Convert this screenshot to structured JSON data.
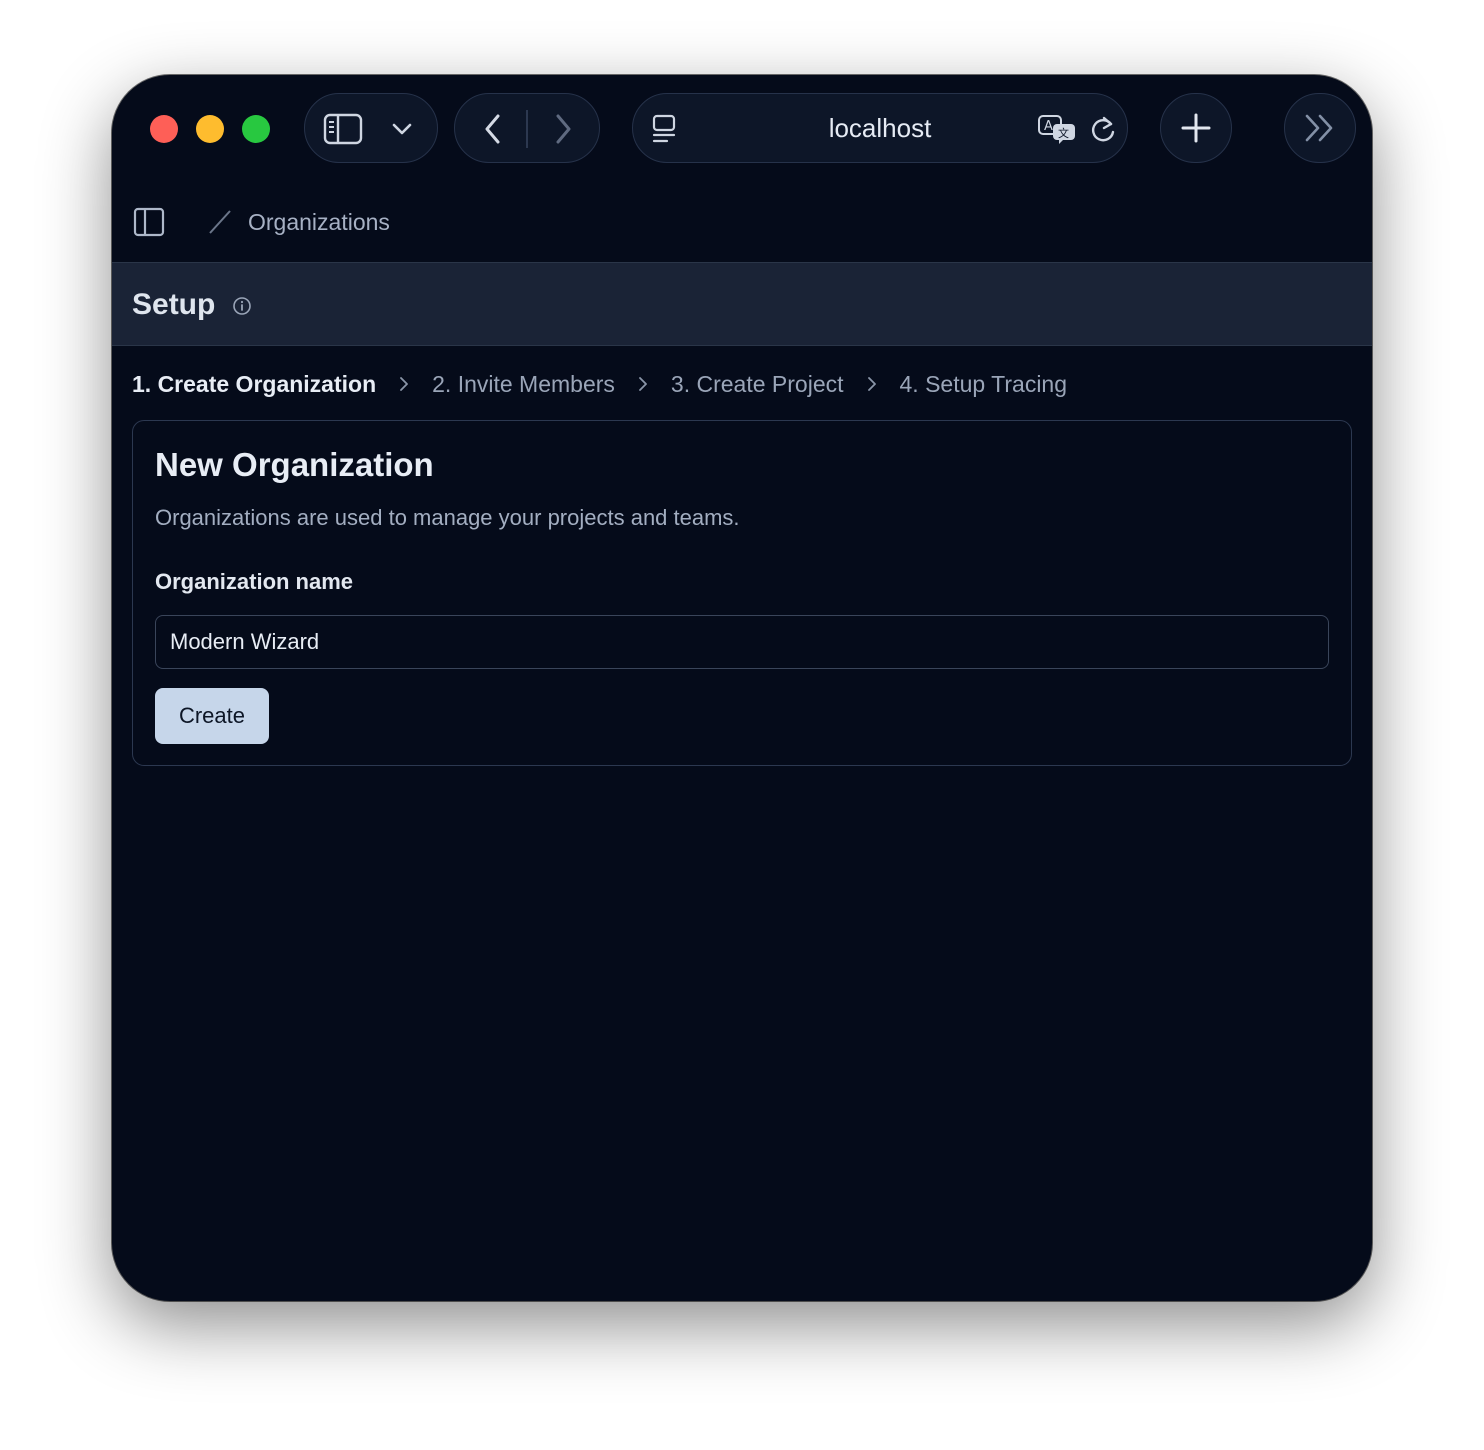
{
  "browser": {
    "url": "localhost",
    "icons": {
      "sidebar": "sidebar-icon",
      "dropdown": "chevron-down-icon",
      "back": "chevron-left-icon",
      "forward": "chevron-right-icon",
      "page_menu": "page-menu-icon",
      "translate": "translate-icon",
      "reload": "reload-icon",
      "new_tab": "plus-icon",
      "more": "double-chevron-right-icon"
    },
    "traffic_lights": [
      "#fe5f57",
      "#febc2e",
      "#28c840"
    ]
  },
  "app": {
    "breadcrumb": "Organizations",
    "page_title": "Setup",
    "steps": [
      {
        "label": "1. Create Organization",
        "active": true
      },
      {
        "label": "2. Invite Members",
        "active": false
      },
      {
        "label": "3. Create Project",
        "active": false
      },
      {
        "label": "4. Setup Tracing",
        "active": false
      }
    ],
    "card": {
      "title": "New Organization",
      "description": "Organizations are used to manage your projects and teams.",
      "field_label": "Organization name",
      "field_value": "Modern Wizard",
      "submit_label": "Create"
    }
  },
  "colors": {
    "background": "#050b1a",
    "header_bar": "#1a2336",
    "button_bg": "#c6d6ea"
  }
}
